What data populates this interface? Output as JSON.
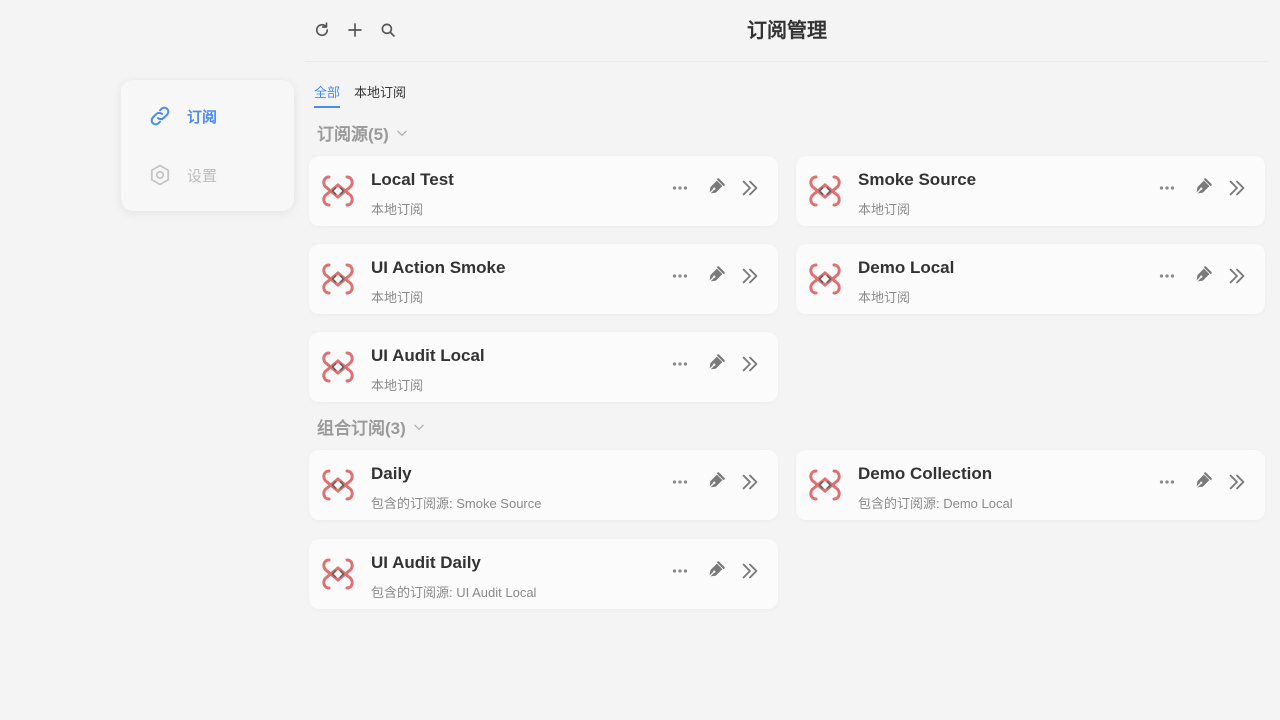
{
  "header": {
    "title": "订阅管理"
  },
  "toolbar": {
    "refresh_icon": "refresh-icon",
    "add_icon": "plus-icon",
    "search_icon": "search-icon"
  },
  "sidebar": {
    "items": [
      {
        "label": "订阅",
        "icon": "link-icon",
        "active": true
      },
      {
        "label": "设置",
        "icon": "gear-icon",
        "active": false
      }
    ]
  },
  "tabs": [
    {
      "label": "全部",
      "active": true
    },
    {
      "label": "本地订阅",
      "active": false
    }
  ],
  "sections": {
    "sources": {
      "title": "订阅源(5)",
      "items": [
        {
          "name": "Local Test",
          "sub": "本地订阅"
        },
        {
          "name": "Smoke Source",
          "sub": "本地订阅"
        },
        {
          "name": "UI Action Smoke",
          "sub": "本地订阅"
        },
        {
          "name": "Demo Local",
          "sub": "本地订阅"
        },
        {
          "name": "UI Audit Local",
          "sub": "本地订阅"
        }
      ]
    },
    "collections": {
      "title": "组合订阅(3)",
      "items": [
        {
          "name": "Daily",
          "sub": "包含的订阅源: Smoke Source"
        },
        {
          "name": "Demo Collection",
          "sub": "包含的订阅源: Demo Local"
        },
        {
          "name": "UI Audit Daily",
          "sub": "包含的订阅源: UI Audit Local"
        }
      ]
    }
  },
  "colors": {
    "accent": "#4a8cf0",
    "logo": "#e07070",
    "muted": "#9a9a9a"
  }
}
